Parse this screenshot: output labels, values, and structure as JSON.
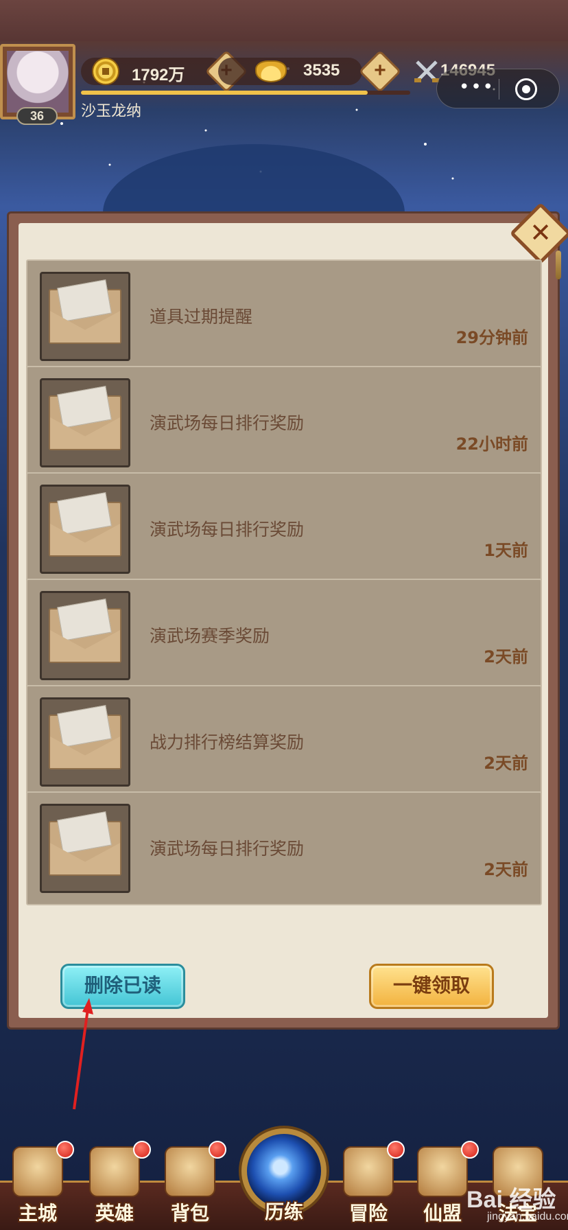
{
  "header": {
    "player": {
      "level": "36",
      "name": "沙玉龙纳"
    },
    "resources": {
      "coins": {
        "value": "1792万",
        "icon": "coin-icon"
      },
      "ingots": {
        "value": "3535",
        "icon": "gold-ingot-icon"
      },
      "power": {
        "value": "146945",
        "icon": "crossed-swords-icon"
      },
      "plus_label": "+"
    },
    "exp_progress": 0.87,
    "capsule": {
      "more_label": "•••",
      "icon": "target-icon"
    }
  },
  "mail_panel": {
    "close_label": "✕",
    "items": [
      {
        "title": "道具过期提醒",
        "time": "29分钟前"
      },
      {
        "title": "演武场每日排行奖励",
        "time": "22小时前"
      },
      {
        "title": "演武场每日排行奖励",
        "time": "1天前"
      },
      {
        "title": "演武场赛季奖励",
        "time": "2天前"
      },
      {
        "title": "战力排行榜结算奖励",
        "time": "2天前"
      },
      {
        "title": "演武场每日排行奖励",
        "time": "2天前"
      }
    ],
    "delete_read_label": "删除已读",
    "claim_all_label": "一键领取"
  },
  "bottom_nav": {
    "items": [
      {
        "label": "主城",
        "icon": "main-city-icon",
        "badge": true
      },
      {
        "label": "英雄",
        "icon": "hero-icon",
        "badge": true
      },
      {
        "label": "背包",
        "icon": "backpack-icon",
        "badge": true
      },
      {
        "label": "历练",
        "icon": "training-orb-icon",
        "badge": false
      },
      {
        "label": "冒险",
        "icon": "adventure-icon",
        "badge": true
      },
      {
        "label": "仙盟",
        "icon": "guild-icon",
        "badge": true
      },
      {
        "label": "法宝",
        "icon": "treasure-icon",
        "badge": false
      }
    ]
  },
  "watermark": {
    "text": "Bai 经验",
    "sub": "jingyan.baidu.com"
  },
  "colors": {
    "panel_bg": "#ede6d6",
    "mail_item_bg": "#a89a86",
    "delete_button": "#43c4d4",
    "claim_button": "#f2b23e",
    "badge_red": "#d21f16"
  }
}
